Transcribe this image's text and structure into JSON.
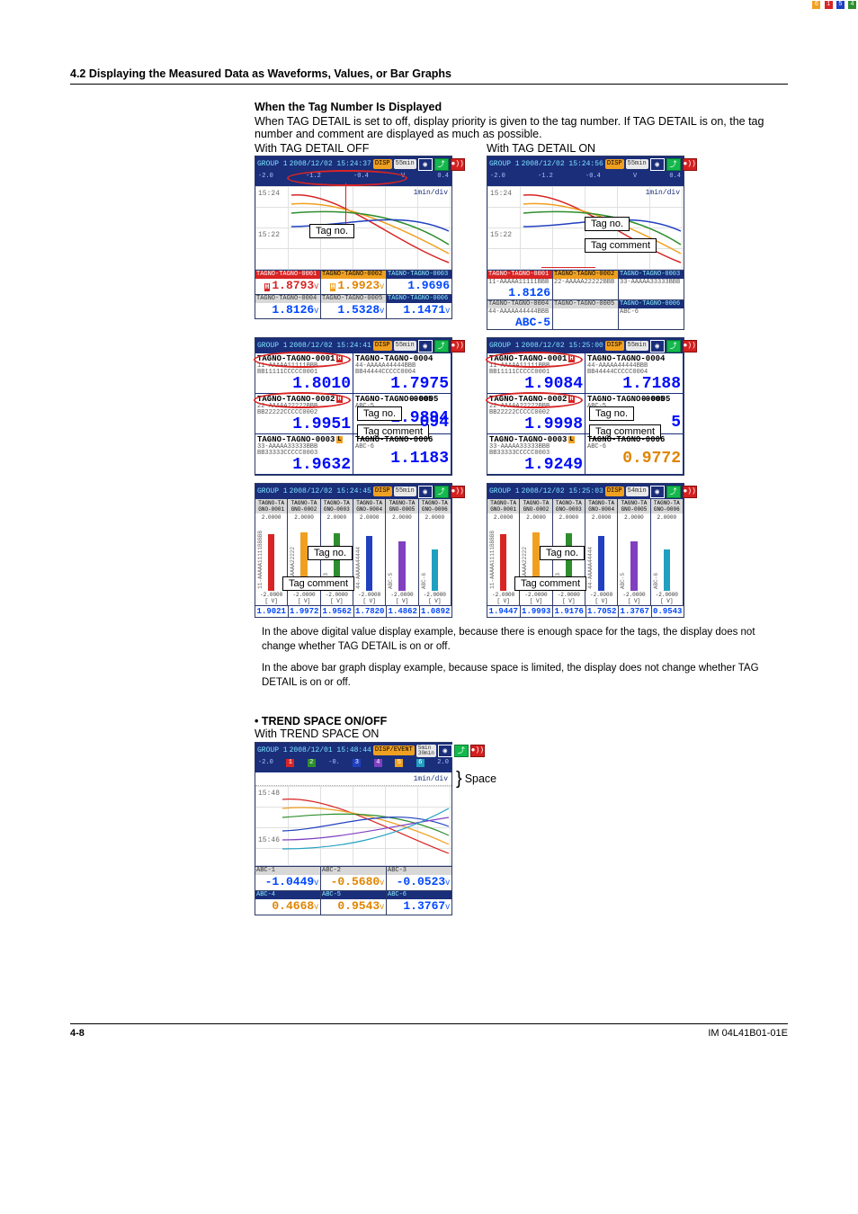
{
  "section_header": "4.2  Displaying the Measured Data as Waveforms, Values, or Bar Graphs",
  "tagnum": {
    "heading": "When the Tag Number Is Displayed",
    "body": "When TAG DETAIL is set to off, display priority is given to the tag number. If TAG DETAIL is on, the tag number and comment are displayed as much as possible.",
    "cap_off": "With TAG DETAIL OFF",
    "cap_on": "With TAG DETAIL ON"
  },
  "labels": {
    "tagno": "Tag no.",
    "tagcomment": "Tag comment",
    "space": "Space"
  },
  "topbar": {
    "group": "GROUP 1",
    "disp": "DISP",
    "dispevent": "DISP/EVENT",
    "t55": "55min",
    "t54": "54min",
    "t5_30": "5min 30min"
  },
  "timestamps": {
    "waveOff": "2008/12/02 15:24:37",
    "waveOn": "2008/12/02 15:24:56",
    "digOff": "2008/12/02 15:24:41",
    "digOn": "2008/12/02 15:25:00",
    "barOff": "2008/12/02 15:24:45",
    "barOn": "2008/12/02 15:25:03",
    "trendOn": "2008/12/01 15:48:44"
  },
  "scale": {
    "v0": "-2.0",
    "v1": "-1.2",
    "v2": "-0.4",
    "v3": "V",
    "v4": "0.4",
    "marks6": "6 1 5 4",
    "trend_right": "2.0",
    "trend_marks": "1 2 3 4 5 6"
  },
  "waveOff": {
    "t1": "15:24",
    "t2": "15:22",
    "rate": "1min/div",
    "row1": [
      {
        "h": "TAGNO-TAGNO-0001",
        "hc": "red",
        "p": "H",
        "v": "1.8793",
        "u": "V",
        "vc": "red"
      },
      {
        "h": "TAGNO-TAGNO-0002",
        "hc": "orange",
        "p": "H",
        "v": "1.9923",
        "u": "V",
        "vc": "or"
      },
      {
        "h": "TAGNO-TAGNO-0003",
        "hc": "dark",
        "v": "1.9696",
        "vc": "blue"
      }
    ],
    "row2": [
      {
        "h": "TAGNO-TAGNO-0004",
        "hc": "grey",
        "v": "1.8126",
        "u": "V",
        "vc": "blue"
      },
      {
        "h": "TAGNO-TAGNO-0005",
        "hc": "grey",
        "v": "1.5328",
        "u": "V",
        "vc": "blue"
      },
      {
        "h": "TAGNO-TAGNO-0006",
        "hc": "dark",
        "v": "1.1471",
        "u": "V",
        "vc": "blue"
      }
    ]
  },
  "waveOn": {
    "t1": "15:24",
    "t2": "15:22",
    "rate": "1min/div",
    "row1": [
      {
        "h": "TAGNO-TAGNO-0001",
        "hc": "red",
        "s": "11-AAAAA11111BBB",
        "v": "1.8126"
      },
      {
        "h": "TAGNO-TAGNO-0002",
        "hc": "orange",
        "s": "22-AAAAA22222BBB",
        "v": ""
      },
      {
        "h": "TAGNO-TAGNO-0003",
        "hc": "dark",
        "s": "33-AAAAA33333BBB",
        "v": ""
      }
    ],
    "row2": [
      {
        "h": "TAGNO-TAGNO-0004",
        "hc": "grey",
        "s": "44-AAAAA44444BBB",
        "v": "ABC-5"
      },
      {
        "h": "TAGNO-TAGNO-0005",
        "hc": "grey",
        "s": "",
        "v": ""
      },
      {
        "h": "TAGNO-TAGNO-0006",
        "hc": "dark",
        "s": "ABC-6",
        "v": ""
      }
    ]
  },
  "dig": {
    "off": [
      {
        "tag": "TAGNO-TAGNO-0001",
        "fl": "H",
        "sub1": "11-AAAAA11111BBB",
        "sub2": "BB11111CCCCC0001",
        "v": "1.8010",
        "u": "V",
        "circ": true
      },
      {
        "tag": "TAGNO-TAGNO-0004",
        "sub1": "44-AAAAA44444BBB",
        "sub2": "BB44444CCCCC0004",
        "v": "1.7975",
        "u": "V"
      },
      {
        "tag": "TAGNO-TAGNO-0002",
        "fl": "H",
        "sub1": "22-AAAAA22222BBB",
        "sub2": "BB22222CCCCC0002",
        "v": "1.9951",
        "u": "V",
        "circ": true
      },
      {
        "tag": "TAGNO-TAGNO-0005",
        "sub1": "ABC-5",
        "v": "1.9894",
        "u": "V",
        "tagno": true,
        "tagcom": true,
        "partial": "0-0005"
      },
      {
        "tag": "TAGNO-TAGNO-0003",
        "fl": "L",
        "sub1": "33-AAAAA33333BBB",
        "sub2": "BB33333CCCCC0003",
        "v": "1.9632",
        "u": "V"
      },
      {
        "tag": "TAGNO-TAGNO-0006",
        "sub1": "ABC-6",
        "v": "1.1183",
        "u": "V"
      }
    ],
    "on": [
      {
        "tag": "TAGNO-TAGNO-0001",
        "fl": "H",
        "sub1": "11-AAAAA11111BBB",
        "sub2": "BB11111CCCCC0001",
        "v": "1.9084",
        "u": "V",
        "circ": true
      },
      {
        "tag": "TAGNO-TAGNO-0004",
        "sub1": "44-AAAAA44444BBB",
        "sub2": "BB44444CCCCC0004",
        "v": "1.7188",
        "u": "V"
      },
      {
        "tag": "TAGNO-TAGNO-0002",
        "fl": "H",
        "sub1": "22-AAAAA22222BBB",
        "sub2": "BB22222CCCCC0002",
        "v": "1.9998",
        "u": "V",
        "circ": true
      },
      {
        "tag": "TAGNO-TAGNO-0005",
        "sub1": "ABC-5",
        "v": "",
        "u": "V",
        "tagno": true,
        "tagcom": true,
        "partial": "0-0005",
        "partialv": "5"
      },
      {
        "tag": "TAGNO-TAGNO-0003",
        "fl": "L",
        "sub1": "33-AAAAA33333BBB",
        "sub2": "BB33333CCCCC0003",
        "v": "1.9249",
        "u": "V"
      },
      {
        "tag": "TAGNO-TAGNO-0006",
        "sub1": "ABC-6",
        "v": "0.9772",
        "u": "V",
        "or": true
      }
    ]
  },
  "bar": {
    "slots": [
      {
        "h1": "TAGNO-TA",
        "h2": "GNO-0001",
        "top": "2.0000",
        "bot": "-2.0000",
        "bh": 82,
        "bc": "#d82424",
        "vt": "11-AAAAA11111BBBBB"
      },
      {
        "h1": "TAGNO-TA",
        "h2": "GNO-0002",
        "top": "2.0000",
        "bot": "-2.0000",
        "bh": 84,
        "bc": "#f0a020",
        "vt": "22-AAAAA22222"
      },
      {
        "h1": "TAGNO-TA",
        "h2": "GNO-0003",
        "top": "2.0000",
        "bot": "-2.0000",
        "bh": 83,
        "bc": "#2e8e2e",
        "vt": "33333"
      },
      {
        "h1": "TAGNO-TA",
        "h2": "GNO-0004",
        "top": "2.0000",
        "bot": "-2.0000",
        "bh": 79,
        "bc": "#2040c0",
        "vt": "44-AAAAA44444"
      },
      {
        "h1": "TAGNO-TA",
        "h2": "GNO-0005",
        "top": "2.0000",
        "bot": "-2.0000",
        "bh": 72,
        "bc": "#8040c0",
        "vt": "ABC-5"
      },
      {
        "h1": "TAGNO-TA",
        "h2": "GNO-0006",
        "top": "2.0000",
        "bot": "-2.0000",
        "bh": 60,
        "bc": "#20a0c0",
        "vt": "ABC-6"
      }
    ],
    "off_v": [
      "1.9021",
      "1.9972",
      "1.9562",
      "1.7820",
      "1.4862",
      "1.0892"
    ],
    "on_v": [
      "1.9447",
      "1.9993",
      "1.9176",
      "1.7052",
      "1.3767",
      "0.9543"
    ],
    "u": "[   V]"
  },
  "notes": {
    "n1": "In the above digital value display example, because there is enough space for the tags, the display does not change whether TAG DETAIL is on or off.",
    "n2": "In the above bar graph display example, because space is limited, the display does not change whether TAG DETAIL is on or off."
  },
  "trend": {
    "head": "TREND SPACE ON/OFF",
    "cap": "With TREND SPACE ON",
    "t1": "15:48",
    "t2": "15:46",
    "rate": "1min/div",
    "row1": [
      {
        "h": "ABC-1",
        "hc": "grey",
        "v": "-1.0449",
        "u": "V",
        "vc": "blue"
      },
      {
        "h": "ABC-2",
        "hc": "grey",
        "v": "-0.5680",
        "u": "V",
        "vc": "or"
      },
      {
        "h": "ABC-3",
        "hc": "grey",
        "v": "-0.0523",
        "u": "V",
        "vc": "blue"
      }
    ],
    "row2": [
      {
        "h": "ABC-4",
        "hc": "dark",
        "v": "0.4668",
        "u": "V",
        "vc": "or"
      },
      {
        "h": "ABC-5",
        "hc": "dark",
        "v": "0.9543",
        "u": "V",
        "vc": "or"
      },
      {
        "h": "ABC-6",
        "hc": "dark",
        "v": "1.3767",
        "u": "V",
        "vc": "blue"
      }
    ]
  },
  "footer": {
    "page": "4-8",
    "doc": "IM 04L41B01-01E"
  }
}
